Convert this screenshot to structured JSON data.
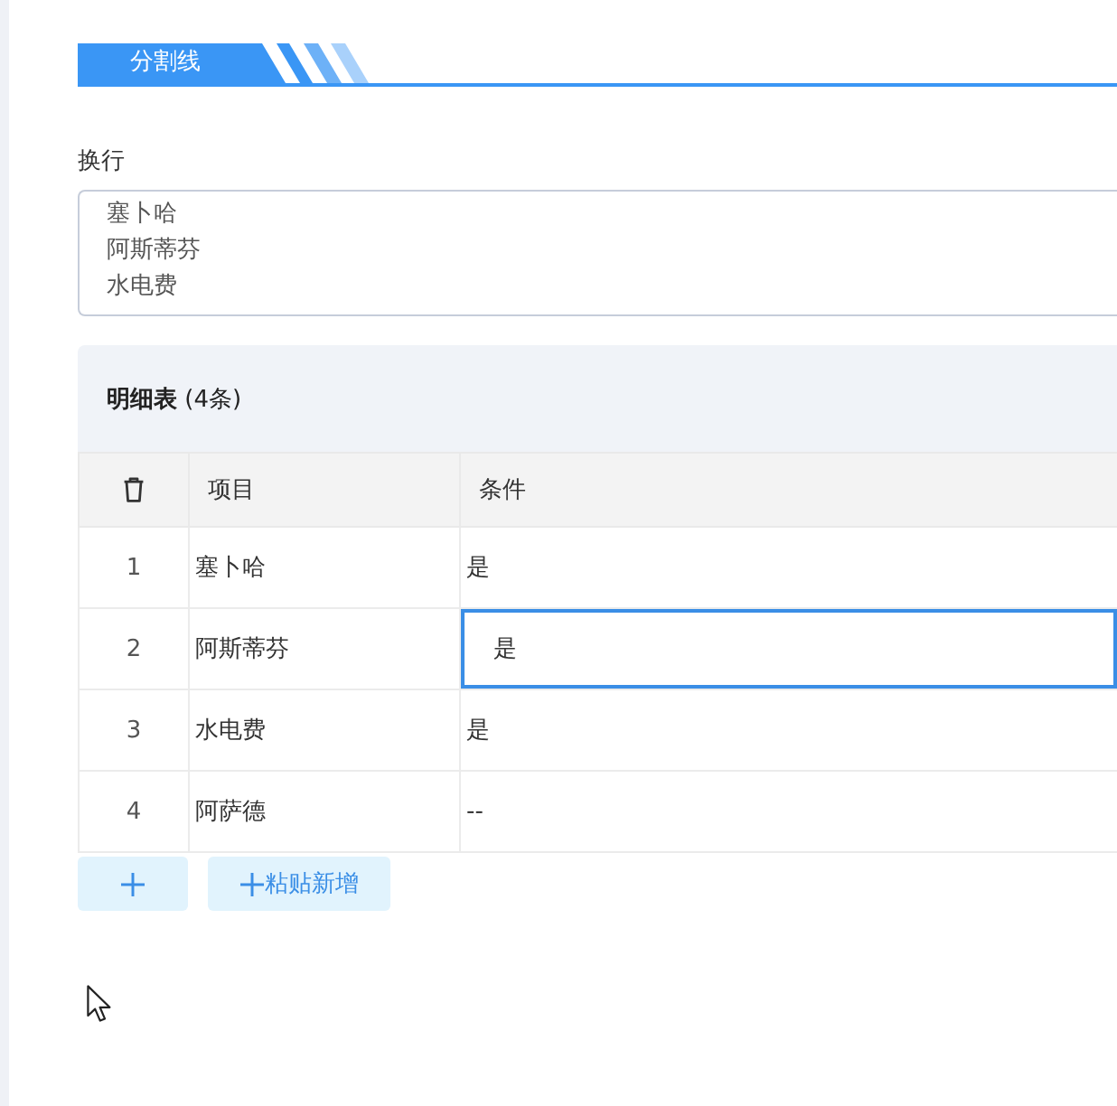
{
  "divider": {
    "title": "分割线"
  },
  "wrap_field": {
    "label": "换行",
    "lines": [
      "塞卜哈",
      "阿斯蒂芬",
      "水电费"
    ]
  },
  "detail_table": {
    "title": "**明细表** (4条)",
    "columns": [
      "项目",
      "条件"
    ],
    "rows": [
      {
        "index": "1",
        "item": "塞卜哈",
        "condition": "是",
        "editing": false
      },
      {
        "index": "2",
        "item": "阿斯蒂芬",
        "condition": "是",
        "editing": true
      },
      {
        "index": "3",
        "item": "水电费",
        "condition": "是",
        "editing": false
      },
      {
        "index": "4",
        "item": "阿萨德",
        "condition": "--",
        "editing": false
      }
    ],
    "buttons": [
      {
        "kind": "add"
      },
      {
        "kind": "paste",
        "label": "粘贴新增"
      }
    ]
  }
}
